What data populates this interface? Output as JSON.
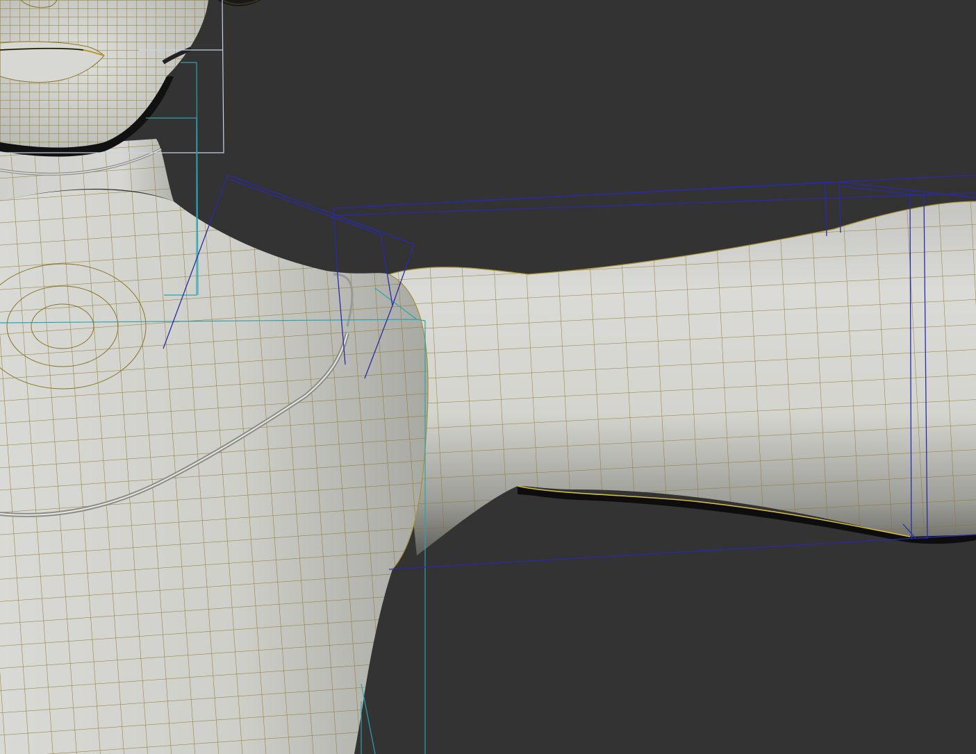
{
  "viewport": {
    "background_color": "#333333",
    "shading": "smooth-shaded-with-wireframe",
    "mesh_surface_color": "#cfcfcb",
    "wireframe_color": "#8a7420",
    "selection_edge_color": "#d4bd3a",
    "bone_outline_color": "#2a2aa8",
    "helper_outline_color": "#2ba3ad",
    "bounding_box_color": "#c7d3e6"
  },
  "scene": {
    "subject": "character-mesh-neck-shoulder-arm",
    "objects": [
      {
        "name": "head-chin",
        "kind": "mesh"
      },
      {
        "name": "neck",
        "kind": "mesh"
      },
      {
        "name": "torso-shoulder",
        "kind": "mesh"
      },
      {
        "name": "upper-arm",
        "kind": "mesh"
      },
      {
        "name": "clavicle-bone",
        "kind": "bone"
      },
      {
        "name": "upper-arm-bone",
        "kind": "bone"
      },
      {
        "name": "forearm-bone",
        "kind": "bone"
      },
      {
        "name": "spine-helper",
        "kind": "helper"
      },
      {
        "name": "neck-helper",
        "kind": "helper"
      },
      {
        "name": "head-bounding-box",
        "kind": "helper"
      }
    ]
  }
}
